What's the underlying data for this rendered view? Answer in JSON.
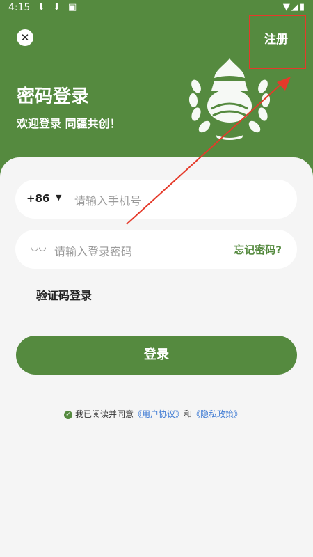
{
  "status_bar": {
    "time": "4:15"
  },
  "header": {
    "close_icon": "close-icon",
    "register_label": "注册",
    "title": "密码登录",
    "subtitle": "欢迎登录 同疆共创！"
  },
  "form": {
    "country_code": "+86",
    "phone_placeholder": "请输入手机号",
    "password_placeholder": "请输入登录密码",
    "forgot_password": "忘记密码?",
    "sms_login": "验证码登录",
    "login_button": "登录"
  },
  "agreement": {
    "prefix": "我已阅读并同意",
    "user_agreement": "《用户协议》",
    "and": "和",
    "privacy_policy": "《隐私政策》"
  },
  "colors": {
    "brand_green": "#558a3f",
    "highlight_red": "#e53a2a",
    "link_blue": "#3f7bd4"
  }
}
